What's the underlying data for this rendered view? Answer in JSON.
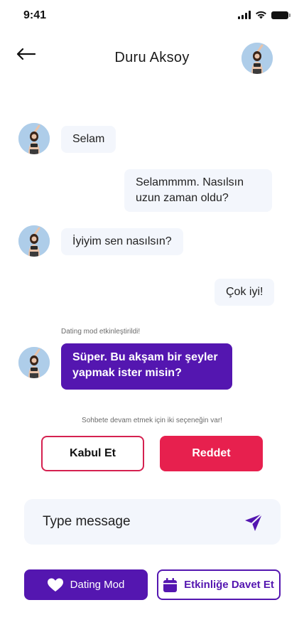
{
  "status_bar": {
    "time": "9:41"
  },
  "header": {
    "title": "Duru Aksoy"
  },
  "messages": [
    {
      "text": "Selam"
    },
    {
      "text": "Selammmm. Nasılsın uzun zaman oldu?"
    },
    {
      "text": "İyiyim sen nasılsın?"
    },
    {
      "text": "Çok iyi!"
    },
    {
      "text": "Süper. Bu akşam bir şeyler yapmak ister misin?"
    }
  ],
  "notes": {
    "dating_enabled": "Dating mod etkinleştirildi!",
    "options_hint": "Sohbete devam etmek için iki seçeneğin var!"
  },
  "actions": {
    "accept_label": "Kabul Et",
    "reject_label": "Reddet"
  },
  "composer": {
    "placeholder": "Type message"
  },
  "bottom": {
    "dating_label": "Dating Mod",
    "invite_label": "Etkinliğe Davet Et"
  },
  "colors": {
    "accent": "#5416b0",
    "danger": "#e7204e",
    "bubble": "#f3f6fc"
  }
}
